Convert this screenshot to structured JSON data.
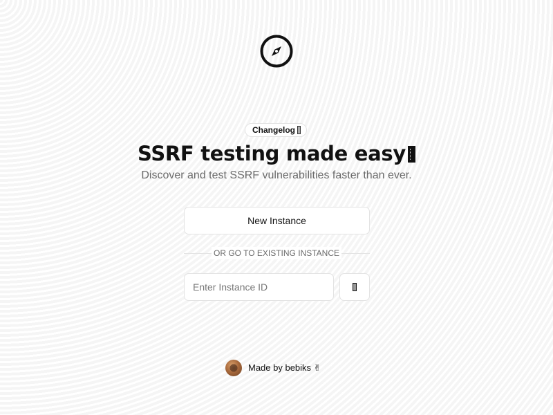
{
  "brand": {
    "logo_icon": "compass-icon"
  },
  "changelog": {
    "label": "Changelog",
    "icon": "external-link-icon"
  },
  "hero": {
    "title": "SSRF testing made easy",
    "title_icon": "emoji-icon",
    "subtitle": "Discover and test SSRF vulnerabilities faster than ever."
  },
  "actions": {
    "new_instance_label": "New Instance",
    "divider_label": "OR GO TO EXISTING INSTANCE",
    "instance_input_placeholder": "Enter Instance ID",
    "instance_input_value": "",
    "go_button_icon": "arrow-right-icon"
  },
  "footer": {
    "text": "Made by bebiks ✌",
    "avatar": "avatar-image"
  }
}
